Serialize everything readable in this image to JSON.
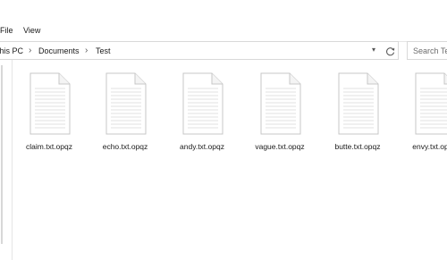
{
  "ribbon": {
    "tabs": [
      "File",
      "View"
    ]
  },
  "address": {
    "crumbs": [
      "This PC",
      "Documents",
      "Test"
    ]
  },
  "search": {
    "placeholder": "Search Test"
  },
  "files": [
    {
      "name": "claim.txt.opqz"
    },
    {
      "name": "echo.txt.opqz"
    },
    {
      "name": "andy.txt.opqz"
    },
    {
      "name": "vague.txt.opqz"
    },
    {
      "name": "butte.txt.opqz"
    },
    {
      "name": "envy.txt.opqz"
    }
  ],
  "colors": {
    "accent": "#0078d7",
    "border": "#d9d9d9"
  }
}
